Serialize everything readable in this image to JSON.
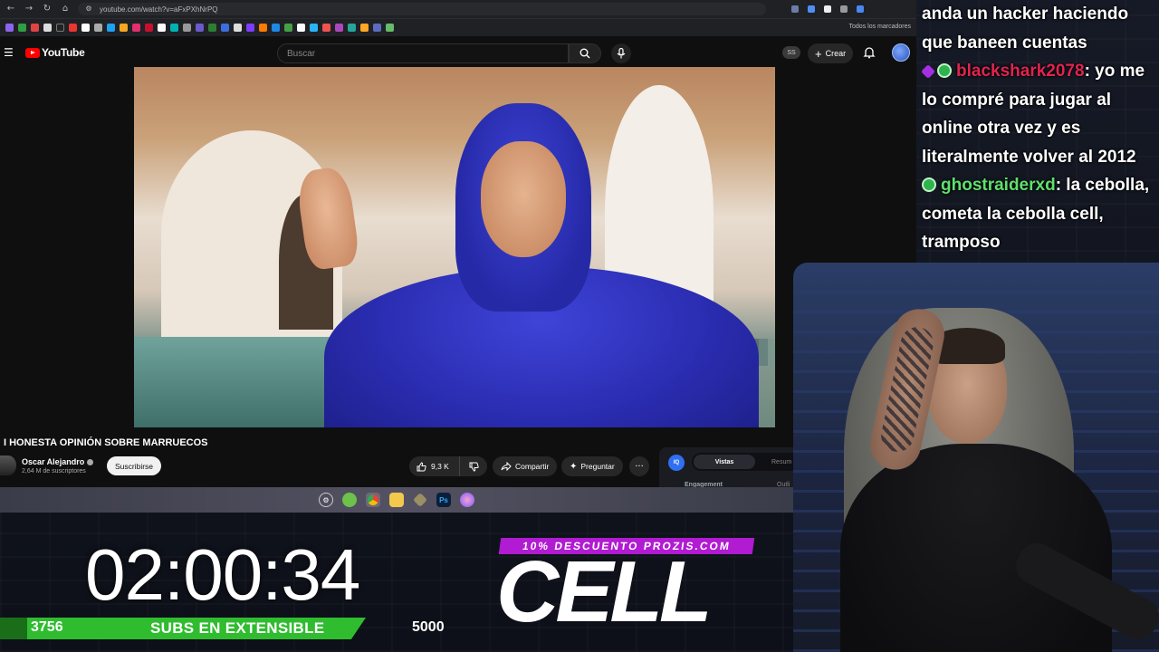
{
  "browser": {
    "url": "youtube.com/watch?v=aFxPXhNrPQ",
    "bookmarks_all_label": "Todos los marcadores"
  },
  "youtube": {
    "logo_text": "YouTube",
    "search_placeholder": "Buscar",
    "ss_badge": "SS",
    "create_label": "Crear"
  },
  "video": {
    "title": "I HONESTA OPINIÓN SOBRE MARRUECOS",
    "channel_name": "Oscar Alejandro",
    "subscriber_count": "2,64 M de suscriptores",
    "subscribe_label": "Suscribirse",
    "like_count": "9,3 K",
    "share_label": "Compartir",
    "ask_label": "Preguntar"
  },
  "vidiq": {
    "logo": "IQ",
    "tab_views": "Vistas",
    "tab_summary": "Resum",
    "engagement_label": "Engagement",
    "outline_label": "Outli"
  },
  "chat": {
    "top_text": "anda un hacker haciendo que baneen cuentas",
    "messages": [
      {
        "user": "blackshark2078",
        "text": ": yo me lo compré para jugar al online otra vez y es literalmente volver al 2012"
      },
      {
        "user": "ghostraiderxd",
        "text": ": la cebolla, cometa la cebolla cell, tramposo"
      }
    ]
  },
  "overlay": {
    "timer": "02:00:34",
    "subs_current": "3756",
    "subs_label": "SUBS EN EXTENSIBLE",
    "subs_goal": "5000",
    "promo": "10% DESCUENTO PROZIS.COM",
    "brand": "CELL",
    "subs_progress": 0.751
  },
  "colors": {
    "youtube_red": "#ff0000",
    "progress_green": "#2fbc2f",
    "promo_purple": "#b11bd1",
    "chat_user_red": "#e0244f",
    "chat_user_green": "#5fe06d"
  }
}
